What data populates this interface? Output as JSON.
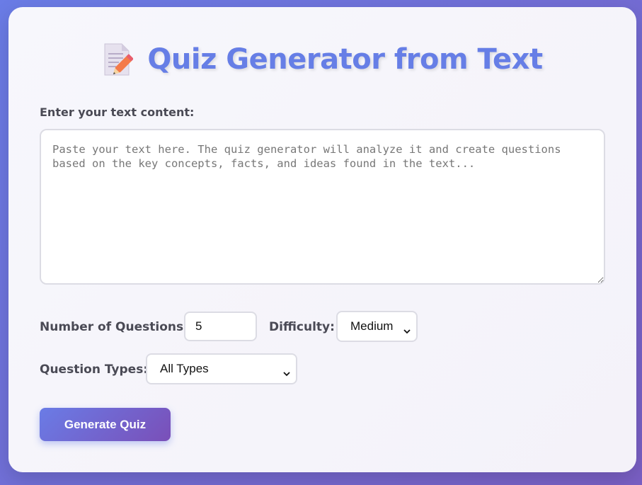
{
  "header": {
    "title": "Quiz Generator from Text",
    "icon": "memo-pencil-icon"
  },
  "text_input": {
    "label": "Enter your text content:",
    "placeholder": "Paste your text here. The quiz generator will analyze it and create questions based on the key concepts, facts, and ideas found in the text...",
    "value": ""
  },
  "options": {
    "num_questions_label": "Number of Questions:",
    "num_questions_value": "5",
    "difficulty_label": "Difficulty:",
    "difficulty_value": "Medium",
    "question_types_label": "Question Types:",
    "question_types_value": "All Types"
  },
  "actions": {
    "generate_label": "Generate Quiz"
  },
  "colors": {
    "accent": "#667ee6",
    "button_gradient_start": "#6a7ce6",
    "button_gradient_end": "#7a4fb8"
  }
}
